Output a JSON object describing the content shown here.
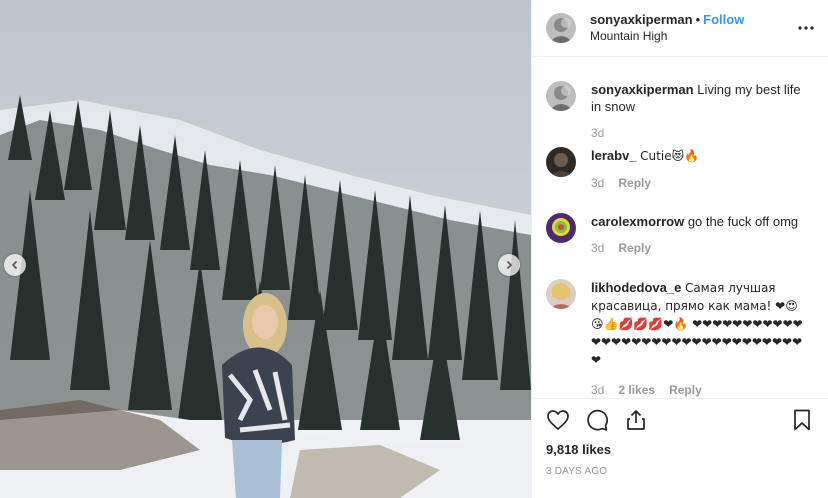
{
  "post": {
    "author": "sonyaxkiperman",
    "follow_label": "Follow",
    "separator": "•",
    "location": "Mountain High",
    "caption": "Living my best life in snow",
    "caption_age": "3d"
  },
  "comments": [
    {
      "user": "lerabv_",
      "text": "Cutie😻🔥",
      "age": "3d",
      "reply_label": "Reply"
    },
    {
      "user": "carolexmorrow",
      "text": "go the fuck off omg",
      "age": "3d",
      "reply_label": "Reply"
    },
    {
      "user": "likhodedova_e",
      "text": "Самая лучшая красавица, прямо как мама! ❤😍😘👍💋💋💋❤🔥 ❤❤❤❤❤❤❤❤❤❤❤❤❤❤❤❤❤❤❤❤❤❤❤❤❤❤❤❤❤❤❤❤❤",
      "age": "3d",
      "likes": "2 likes",
      "reply_label": "Reply"
    }
  ],
  "stats": {
    "likes": "9,818 likes",
    "timestamp": "3 DAYS AGO"
  },
  "icons": {
    "prev": "chevron-left-icon",
    "next": "chevron-right-icon",
    "more": "more-horizontal-icon",
    "like": "heart-icon",
    "comment": "comment-icon",
    "share": "share-icon",
    "save": "bookmark-icon"
  },
  "colors": {
    "link": "#3897f0",
    "muted": "#999999",
    "text": "#262626"
  }
}
